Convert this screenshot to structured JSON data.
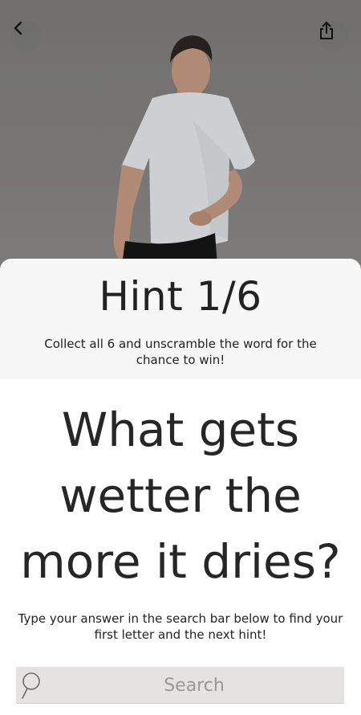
{
  "header": {
    "back_icon": "chevron-left-icon",
    "share_icon": "share-icon"
  },
  "hint": {
    "title": "Hint 1/6",
    "subtitle": "Collect all 6 and unscramble the word for the chance to win!"
  },
  "riddle": {
    "text": "What gets wetter the more it dries?"
  },
  "instructions": {
    "text": "Type your answer in the search bar below to find your first letter and the next hint!"
  },
  "search": {
    "placeholder": "Search",
    "value": "",
    "icon": "search-icon"
  },
  "colors": {
    "hero_bg": "#858482",
    "card_bg": "#f7f7f7",
    "search_bg": "#e5e3e2",
    "text": "#222222"
  }
}
